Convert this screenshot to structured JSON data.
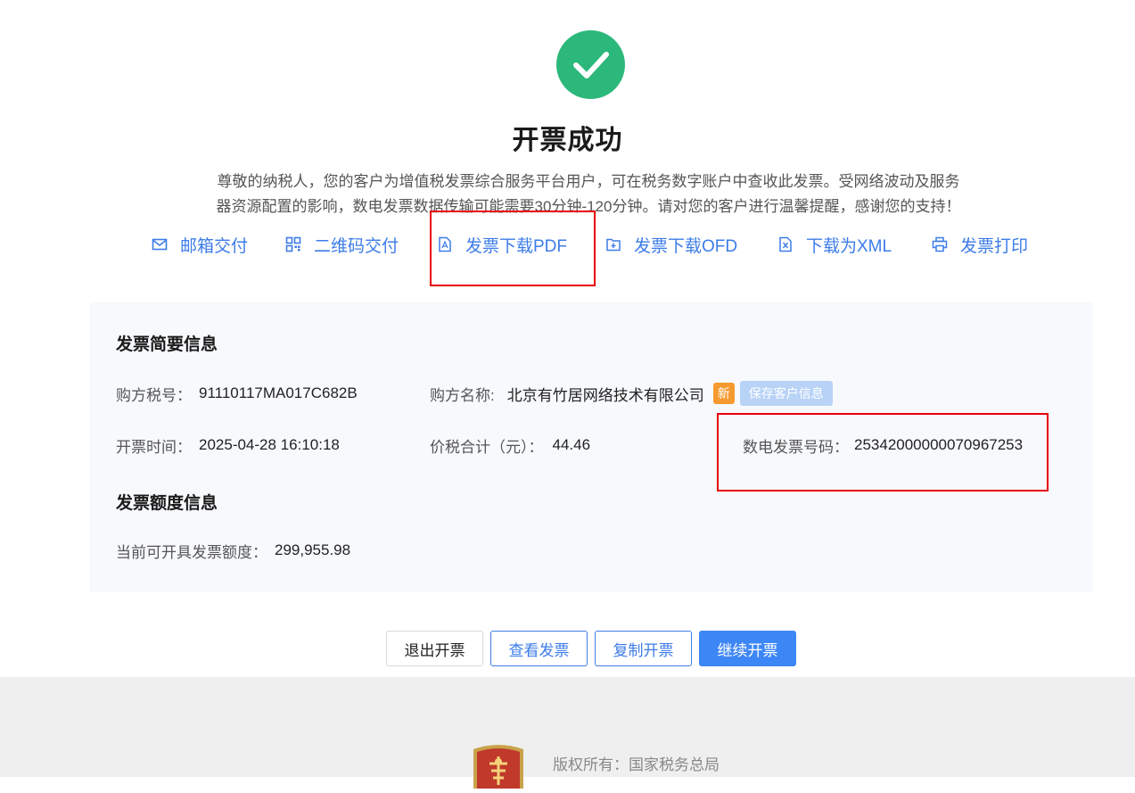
{
  "header": {
    "status_icon": "check-circle-icon",
    "status_color": "#2bb87a",
    "title": "开票成功",
    "notice_line1": "尊敬的纳税人，您的客户为增值税发票综合服务平台用户，可在税务数字账户中查收此发票。受网络波动及服务",
    "notice_line2": "器资源配置的影响，数电发票数据传输可能需要30分钟-120分钟。请对您的客户进行温馨提醒，感谢您的支持！"
  },
  "actions": [
    {
      "label": "邮箱交付",
      "icon": "mail-icon"
    },
    {
      "label": "二维码交付",
      "icon": "qrcode-icon"
    },
    {
      "label": "发票下载PDF",
      "icon": "pdf-icon"
    },
    {
      "label": "发票下载OFD",
      "icon": "ofd-icon"
    },
    {
      "label": "下载为XML",
      "icon": "xml-icon"
    },
    {
      "label": "发票打印",
      "icon": "printer-icon"
    }
  ],
  "summary": {
    "title": "发票简要信息",
    "buyer_tax_id_label": "购方税号：",
    "buyer_tax_id": "91110117MA017C682B",
    "buyer_name_label": "购方名称:",
    "buyer_name": "北京有竹居网络技术有限公司",
    "new_badge": "新",
    "save_customer_label": "保存客户信息",
    "issue_time_label": "开票时间：",
    "issue_time": "2025-04-28 16:10:18",
    "total_label": "价税合计（元）：",
    "total": "44.46",
    "invoice_no_label": "数电发票号码：",
    "invoice_no": "25342000000070967253"
  },
  "quota": {
    "title": "发票额度信息",
    "available_label": "当前可开具发票额度：",
    "available": "299,955.98"
  },
  "buttons": {
    "exit": "退出开票",
    "view": "查看发票",
    "copy": "复制开票",
    "continue": "继续开票"
  },
  "footer": {
    "copyright": "版权所有：国家税务总局"
  },
  "colors": {
    "accent": "#3d7ce8",
    "primary_button": "#3d86f5",
    "highlight_box": "#e8000b",
    "new_badge": "#f59a30"
  }
}
